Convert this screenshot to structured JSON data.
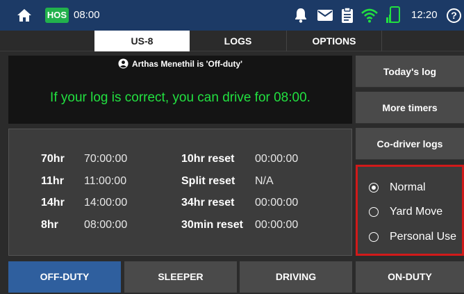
{
  "statusbar": {
    "hos_badge": "HOS",
    "hos_time": "08:00",
    "clock": "12:20",
    "help": "?",
    "icons": [
      "home-icon",
      "bell-icon",
      "mail-icon",
      "clipboard-icon",
      "wifi-icon",
      "phone-icon",
      "help-icon"
    ],
    "colors": {
      "bar": "#1c3a66",
      "hos": "#22b14c",
      "wifi": "#22e040"
    }
  },
  "tabs": [
    {
      "label": "US-8",
      "active": true
    },
    {
      "label": "LOGS",
      "active": false
    },
    {
      "label": "OPTIONS",
      "active": false
    }
  ],
  "message": {
    "driver_status": "Arthas Menethil is 'Off-duty'",
    "drive_text": "If your log is correct, you can drive for 08:00.",
    "drive_color": "#22e040"
  },
  "timers": {
    "left": [
      {
        "label": "70hr",
        "value": "70:00:00"
      },
      {
        "label": "11hr",
        "value": "11:00:00"
      },
      {
        "label": "14hr",
        "value": "14:00:00"
      },
      {
        "label": "8hr",
        "value": "08:00:00"
      }
    ],
    "right": [
      {
        "label": "10hr reset",
        "value": "00:00:00"
      },
      {
        "label": "Split reset",
        "value": "N/A"
      },
      {
        "label": "34hr reset",
        "value": "00:00:00"
      },
      {
        "label": "30min reset",
        "value": "00:00:00"
      }
    ]
  },
  "side_buttons": {
    "todays_log": "Today's log",
    "more_timers": "More timers",
    "co_driver_logs": "Co-driver logs"
  },
  "drive_mode": {
    "options": [
      "Normal",
      "Yard Move",
      "Personal Use"
    ],
    "selected": "Normal",
    "highlight_color": "#d11a1a"
  },
  "duty_status": {
    "buttons": [
      "OFF-DUTY",
      "SLEEPER",
      "DRIVING",
      "ON-DUTY"
    ],
    "active": "OFF-DUTY",
    "active_color": "#2f5f9e"
  }
}
